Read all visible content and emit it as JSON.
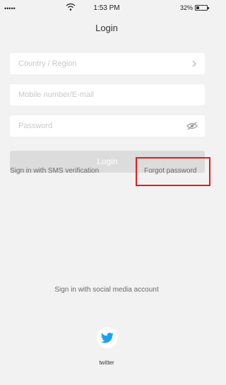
{
  "status_bar": {
    "signal": "•••••",
    "time": "1:53 PM",
    "battery_text": "32%",
    "battery_level": 0.32
  },
  "nav": {
    "title": "Login"
  },
  "form": {
    "country_placeholder": "Country / Region",
    "account_placeholder": "Mobile number/E-mail",
    "password_placeholder": "Password",
    "login_label": "Login"
  },
  "links": {
    "sms": "Sign in with SMS verification",
    "forgot": "Forgot password"
  },
  "social": {
    "label": "Sign in with social media account",
    "twitter_label": "twitter"
  },
  "colors": {
    "highlight": "#e21b1b",
    "twitter": "#1da1f2",
    "button_disabled": "#dcdcdc"
  },
  "icons": [
    "wifi-icon",
    "battery-icon",
    "chevron-right-icon",
    "eye-hidden-icon",
    "twitter-icon"
  ]
}
